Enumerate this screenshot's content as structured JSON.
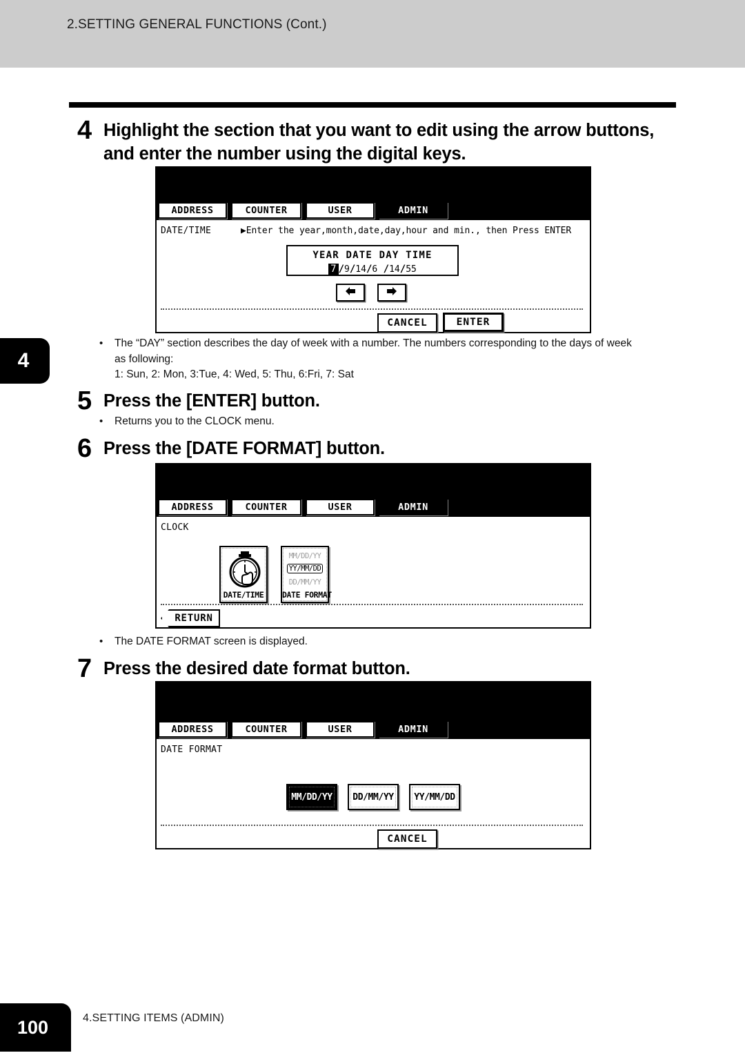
{
  "page": {
    "header_title": "2.SETTING GENERAL FUNCTIONS (Cont.)",
    "chapter_tab": "4",
    "page_number": "100",
    "footer_title": "4.SETTING ITEMS (ADMIN)"
  },
  "steps": {
    "step4": {
      "number": "4",
      "text": "Highlight the section that you want to edit using the arrow buttons, and enter the number using the digital keys."
    },
    "step5": {
      "number": "5",
      "text": "Press the [ENTER] button.",
      "note": "Returns you to the CLOCK menu."
    },
    "step6": {
      "number": "6",
      "text": "Press the [DATE FORMAT] button.",
      "note": "The DATE FORMAT screen is displayed."
    },
    "step7": {
      "number": "7",
      "text": "Press the desired date format button."
    }
  },
  "notes": {
    "day_note_line1": "The “DAY” section describes the day of week with a number.  The numbers corresponding to the days of week",
    "day_note_line2": "as following:",
    "day_note_line3": "1: Sun, 2: Mon, 3:Tue, 4: Wed, 5: Thu, 6:Fri, 7: Sat",
    "bullet": "•"
  },
  "panel1": {
    "tabs": [
      {
        "label": "ADDRESS",
        "active": false
      },
      {
        "label": "COUNTER",
        "active": false
      },
      {
        "label": "USER",
        "active": false
      },
      {
        "label": "ADMIN",
        "active": true
      }
    ],
    "screen_label": "DATE/TIME",
    "hint": "▶Enter the year,month,date,day,hour and min., then Press ENTER",
    "value_box": {
      "headers": "YEAR  DATE  DAY   TIME",
      "year": "7",
      "month": "9",
      "date": "14",
      "day": "6",
      "hour": "14",
      "min": "55",
      "separator": "/"
    },
    "arrow_left_icon": "arrow-left-icon",
    "arrow_right_icon": "arrow-right-icon",
    "cancel_label": "CANCEL",
    "enter_label": "ENTER"
  },
  "panel2": {
    "tabs": [
      {
        "label": "ADDRESS",
        "active": false
      },
      {
        "label": "COUNTER",
        "active": false
      },
      {
        "label": "USER",
        "active": false
      },
      {
        "label": "ADMIN",
        "active": true
      }
    ],
    "screen_label": "CLOCK",
    "tiles": [
      {
        "caption": "DATE/TIME",
        "icon": "stopwatch-icon"
      },
      {
        "caption": "DATE FORMAT",
        "icon": "date-format-icon",
        "lines": [
          {
            "text": "MM/DD/YY",
            "state": "dim"
          },
          {
            "text": "YY/MM/DD",
            "state": "boxed"
          },
          {
            "text": "DD/MM/YY",
            "state": "dim"
          }
        ]
      }
    ],
    "return_label": "RETURN"
  },
  "panel3": {
    "tabs": [
      {
        "label": "ADDRESS",
        "active": false
      },
      {
        "label": "COUNTER",
        "active": false
      },
      {
        "label": "USER",
        "active": false
      },
      {
        "label": "ADMIN",
        "active": true
      }
    ],
    "screen_label": "DATE FORMAT",
    "format_buttons": [
      {
        "label": "MM/DD/YY",
        "selected": true
      },
      {
        "label": "DD/MM/YY",
        "selected": false
      },
      {
        "label": "YY/MM/DD",
        "selected": false
      }
    ],
    "cancel_label": "CANCEL"
  }
}
